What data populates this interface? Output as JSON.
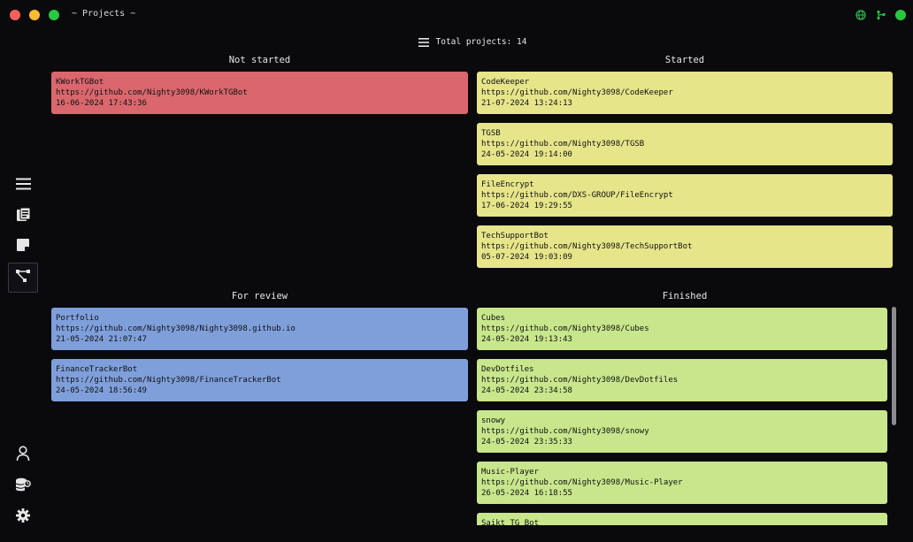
{
  "window": {
    "title": "~ Projects ~"
  },
  "header": {
    "total_projects": "Total projects: 14"
  },
  "columns": {
    "not_started": {
      "title": "Not started",
      "cards": [
        {
          "name": "KWorkTGBot",
          "url": "https://github.com/Nighty3098/KWorkTGBot",
          "date": "16-06-2024 17:43:36"
        }
      ]
    },
    "started": {
      "title": "Started",
      "cards": [
        {
          "name": "CodeKeeper",
          "url": "https://github.com/Nighty3098/CodeKeeper",
          "date": "21-07-2024 13:24:13"
        },
        {
          "name": "TGSB",
          "url": "https://github.com/Nighty3098/TGSB",
          "date": "24-05-2024 19:14:00"
        },
        {
          "name": "FileEncrypt",
          "url": "https://github.com/DXS-GROUP/FileEncrypt",
          "date": "17-06-2024 19:29:55"
        },
        {
          "name": "TechSupportBot",
          "url": "https://github.com/Nighty3098/TechSupportBot",
          "date": "05-07-2024 19:03:09"
        }
      ]
    },
    "for_review": {
      "title": "For review",
      "cards": [
        {
          "name": "Portfolio",
          "url": "https://github.com/Nighty3098/Nighty3098.github.io",
          "date": "21-05-2024 21:07:47"
        },
        {
          "name": "FinanceTrackerBot",
          "url": "https://github.com/Nighty3098/FinanceTrackerBot",
          "date": "24-05-2024 18:56:49"
        }
      ]
    },
    "finished": {
      "title": "Finished",
      "cards": [
        {
          "name": "Cubes",
          "url": "https://github.com/Nighty3098/Cubes",
          "date": "24-05-2024 19:13:43"
        },
        {
          "name": "DevDotfiles",
          "url": "https://github.com/Nighty3098/DevDotfiles",
          "date": "24-05-2024 23:34:58"
        },
        {
          "name": "snowy",
          "url": "https://github.com/Nighty3098/snowy",
          "date": "24-05-2024 23:35:33"
        },
        {
          "name": "Music-Player",
          "url": "https://github.com/Nighty3098/Music-Player",
          "date": "26-05-2024 16:18:55"
        },
        {
          "name": "Saikt TG Bot",
          "url": "",
          "date": ""
        }
      ]
    }
  },
  "colors": {
    "background": "#0a0a0d",
    "not_started": "#d9676d",
    "started": "#e6e58a",
    "for_review": "#7f9fdb",
    "finished": "#c8e68c"
  },
  "icons": {
    "titlebar_right": [
      "globe-icon",
      "git-branch-icon",
      "status-dot"
    ],
    "sidebar": [
      "menu-icon",
      "tasks-icon",
      "notes-icon",
      "projects-icon",
      "account-icon",
      "database-sync-icon",
      "settings-icon"
    ]
  }
}
